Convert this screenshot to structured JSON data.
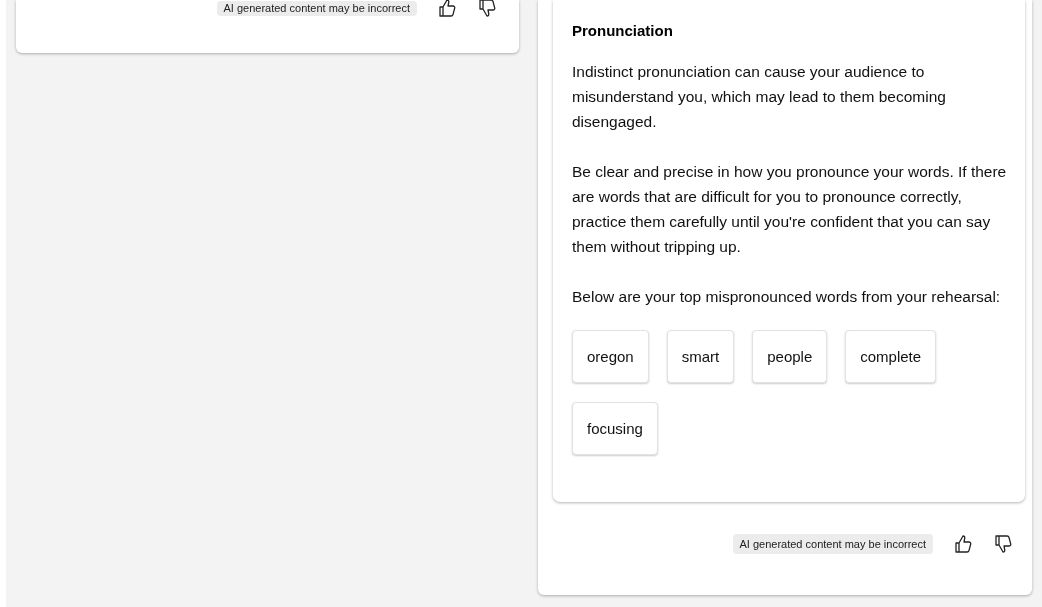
{
  "left_card": {
    "disclaimer": "AI generated content may be incorrect"
  },
  "feedback_card": {
    "heading": "Pronunciation",
    "paragraphs": [
      "Indistinct pronunciation can cause your audience to misunderstand you, which may lead to them becoming disengaged.",
      "Be clear and precise in how you pronounce your words. If there are words that are difficult for you to pronounce correctly, practice them carefully until you're confident that you can say them without tripping up.",
      "Below are your top mispronounced words from your rehearsal:"
    ],
    "words": [
      "oregon",
      "smart",
      "people",
      "complete",
      "focusing"
    ]
  },
  "right_footer": {
    "disclaimer": "AI generated content may be incorrect"
  }
}
